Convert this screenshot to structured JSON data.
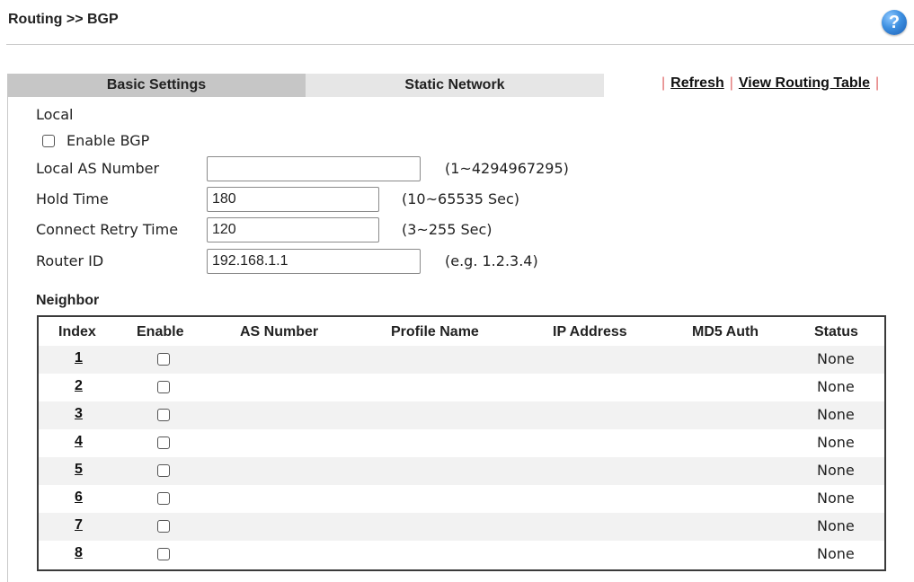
{
  "header": {
    "breadcrumb": "Routing >> BGP",
    "help_glyph": "?"
  },
  "tabs": [
    {
      "label": "Basic Settings",
      "active": true
    },
    {
      "label": "Static Network",
      "active": false
    }
  ],
  "links": {
    "separator": "|",
    "refresh": "Refresh",
    "view_routing_table": "View Routing Table"
  },
  "local": {
    "title": "Local",
    "enable_bgp": {
      "label": "Enable BGP",
      "checked": false
    },
    "local_as": {
      "label": "Local AS Number",
      "value": "",
      "hint": "(1~4294967295)"
    },
    "hold_time": {
      "label": "Hold Time",
      "value": "180",
      "hint": "(10~65535 Sec)"
    },
    "connect_retry": {
      "label": "Connect Retry Time",
      "value": "120",
      "hint": "(3~255 Sec)"
    },
    "router_id": {
      "label": "Router ID",
      "value": "192.168.1.1",
      "hint": "(e.g. 1.2.3.4)"
    }
  },
  "neighbor": {
    "title": "Neighbor",
    "columns": [
      "Index",
      "Enable",
      "AS Number",
      "Profile Name",
      "IP Address",
      "MD5 Auth",
      "Status"
    ],
    "rows": [
      {
        "index": "1",
        "enabled": false,
        "status": "None"
      },
      {
        "index": "2",
        "enabled": false,
        "status": "None"
      },
      {
        "index": "3",
        "enabled": false,
        "status": "None"
      },
      {
        "index": "4",
        "enabled": false,
        "status": "None"
      },
      {
        "index": "5",
        "enabled": false,
        "status": "None"
      },
      {
        "index": "6",
        "enabled": false,
        "status": "None"
      },
      {
        "index": "7",
        "enabled": false,
        "status": "None"
      },
      {
        "index": "8",
        "enabled": false,
        "status": "None"
      }
    ]
  },
  "colors": {
    "active_tab": "#c6c6c6",
    "inactive_tab": "#e6e6e6",
    "separator": "#e06a6a",
    "help_icon": "#3d8fe0"
  }
}
